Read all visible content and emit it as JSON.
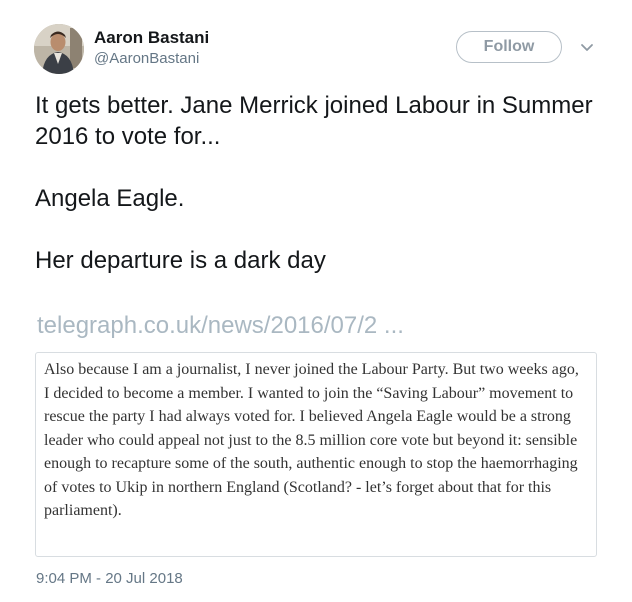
{
  "user": {
    "display_name": "Aaron Bastani",
    "handle": "@AaronBastani"
  },
  "actions": {
    "follow_label": "Follow"
  },
  "tweet": {
    "paragraphs": [
      "It gets better. Jane Merrick joined Labour in Summer 2016 to vote for...",
      "Angela Eagle.",
      "Her departure is a dark day"
    ],
    "link_text": "telegraph.co.uk/news/2016/07/2  ...",
    "quote_text": "Also because I am a journalist, I never joined the Labour Party. But two weeks ago, I decided to become a member. I wanted to join the “Saving Labour” movement to rescue the party I had always voted for.  I believed Angela Eagle would be a strong leader who could appeal not just to the 8.5 million core vote but beyond it: sensible enough to recapture some of the south, authentic enough to stop the haemorrhaging of votes to Ukip in northern England (Scotland? - let’s forget about that for this parliament).",
    "timestamp": "9:04 PM - 20 Jul 2018"
  },
  "icons": {
    "avatar": "avatar-photo",
    "more": "chevron-down-icon"
  },
  "colors": {
    "text_primary": "#14171a",
    "text_secondary": "#657786",
    "link_faded": "#aab8c2",
    "follow_border": "#b7c0c8",
    "quote_border": "#d8dde1"
  }
}
